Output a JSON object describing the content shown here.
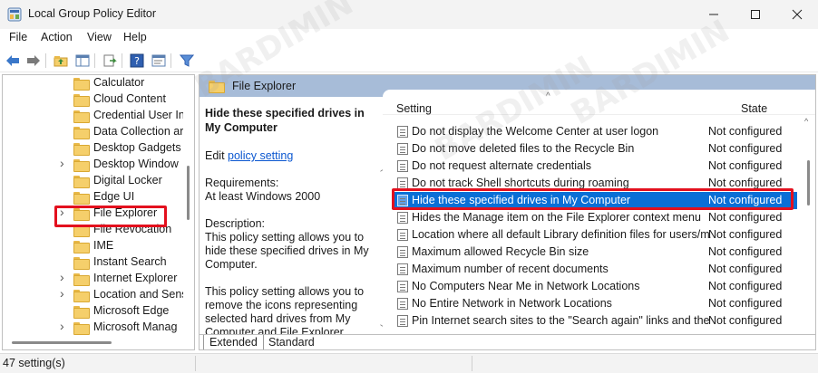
{
  "window": {
    "title": "Local Group Policy Editor",
    "icons": {
      "app": "group-policy-icon",
      "minimize": "minimize-icon",
      "maximize": "maximize-icon",
      "close": "close-icon"
    }
  },
  "menu": [
    "File",
    "Action",
    "View",
    "Help"
  ],
  "toolbar": [
    "back-arrow-icon",
    "forward-arrow-icon",
    "folder-up-icon",
    "show-hide-tree-icon",
    "export-list-icon",
    "help-icon",
    "properties-icon",
    "filter-icon"
  ],
  "tree": {
    "items": [
      {
        "label": "Calculator",
        "expandable": false
      },
      {
        "label": "Cloud Content",
        "expandable": false
      },
      {
        "label": "Credential User In",
        "expandable": false
      },
      {
        "label": "Data Collection ar",
        "expandable": false
      },
      {
        "label": "Desktop Gadgets",
        "expandable": false
      },
      {
        "label": "Desktop Window",
        "expandable": true
      },
      {
        "label": "Digital Locker",
        "expandable": false
      },
      {
        "label": "Edge UI",
        "expandable": false
      },
      {
        "label": "File Explorer",
        "expandable": true
      },
      {
        "label": "File Revocation",
        "expandable": false
      },
      {
        "label": "IME",
        "expandable": false
      },
      {
        "label": "Instant Search",
        "expandable": false
      },
      {
        "label": "Internet Explorer",
        "expandable": true
      },
      {
        "label": "Location and Sens",
        "expandable": true
      },
      {
        "label": "Microsoft Edge",
        "expandable": false
      },
      {
        "label": "Microsoft Manag",
        "expandable": true
      }
    ],
    "selected": "File Explorer"
  },
  "right_header": {
    "title": "File Explorer"
  },
  "description": {
    "title": "Hide these specified drives in My Computer",
    "edit_prefix": "Edit ",
    "edit_link": "policy setting ",
    "requirements_label": "Requirements:",
    "requirements_value": "At least Windows 2000",
    "description_label": "Description:",
    "text1": "This policy setting allows you to hide these specified drives in My Computer.",
    "text2": "This policy setting allows you to remove the icons representing selected hard drives from My Computer and File Explorer. Also,"
  },
  "settings": {
    "columns": {
      "setting": "Setting",
      "state": "State"
    },
    "rows": [
      {
        "name": "Do not display the Welcome Center at user logon",
        "state": "Not configured"
      },
      {
        "name": "Do not move deleted files to the Recycle Bin",
        "state": "Not configured"
      },
      {
        "name": "Do not request alternate credentials",
        "state": "Not configured"
      },
      {
        "name": "Do not track Shell shortcuts during roaming",
        "state": "Not configured"
      },
      {
        "name": "Hide these specified drives in My Computer",
        "state": "Not configured"
      },
      {
        "name": "Hides the Manage item on the File Explorer context menu",
        "state": "Not configured"
      },
      {
        "name": "Location where all default Library definition files for users/m...",
        "state": "Not configured"
      },
      {
        "name": "Maximum allowed Recycle Bin size",
        "state": "Not configured"
      },
      {
        "name": "Maximum number of recent documents",
        "state": "Not configured"
      },
      {
        "name": "No Computers Near Me in Network Locations",
        "state": "Not configured"
      },
      {
        "name": "No Entire Network in Network Locations",
        "state": "Not configured"
      },
      {
        "name": "Pin Internet search sites to the \"Search again\" links and the Sta...",
        "state": "Not configured"
      }
    ],
    "selected_row": 4
  },
  "tabs": [
    "Extended",
    "Standard"
  ],
  "status": {
    "text": "47 setting(s)"
  },
  "watermark": "BARDIMIN"
}
